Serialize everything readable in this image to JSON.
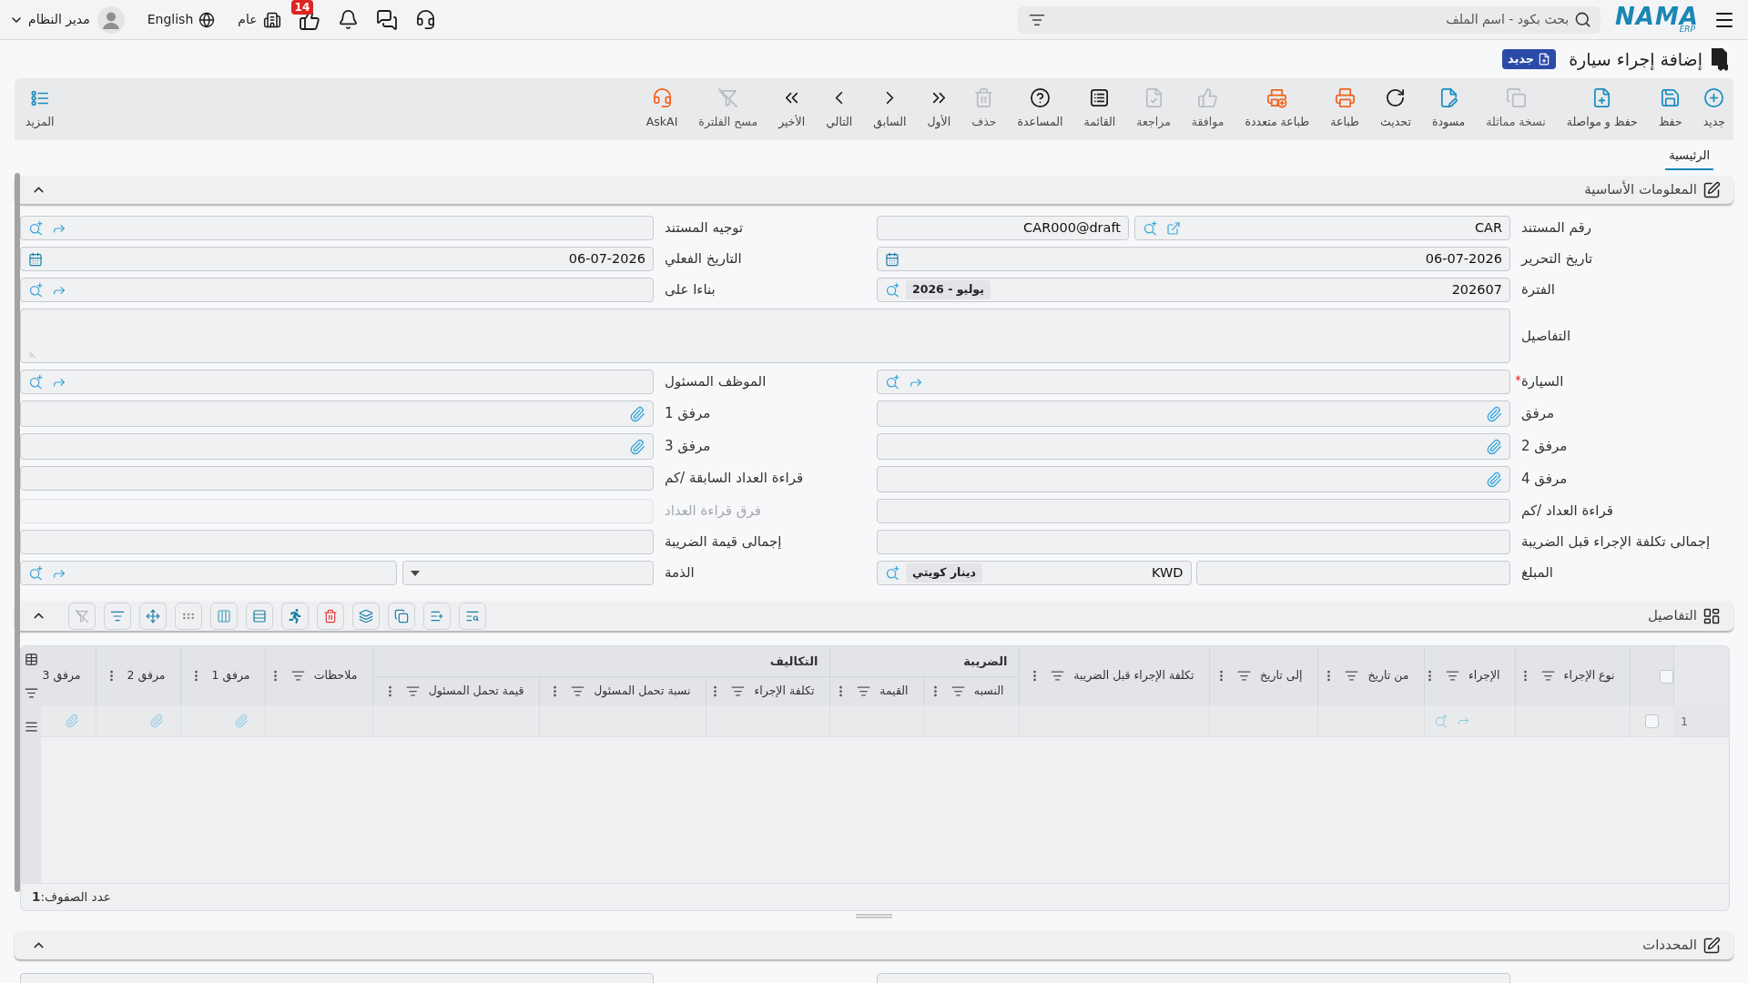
{
  "top_bar": {
    "logo": {
      "name": "NAMA",
      "suffix": "ERP"
    },
    "search": {
      "placeholder": "بحث بكود - اسم الملف"
    },
    "notifications": {
      "badge": "14"
    },
    "company": {
      "label": "عام"
    },
    "language": {
      "label": "English"
    },
    "user": {
      "name": "مدير النظام"
    }
  },
  "page": {
    "title": "إضافة إجراء سيارة",
    "status_badge": "جديد"
  },
  "toolbar": {
    "actions": [
      {
        "label": "جديد",
        "disabled": false
      },
      {
        "label": "حفظ",
        "disabled": false
      },
      {
        "label": "حفظ و مواصلة",
        "disabled": false
      },
      {
        "label": "نسخة مماثلة",
        "disabled": true
      },
      {
        "label": "مسودة",
        "disabled": false
      },
      {
        "label": "تحديث",
        "disabled": false
      },
      {
        "label": "طباعة",
        "disabled": false
      },
      {
        "label": "طباعة متعددة",
        "disabled": false
      },
      {
        "label": "موافقة",
        "disabled": true
      },
      {
        "label": "مراجعة",
        "disabled": true
      },
      {
        "label": "القائمة",
        "disabled": false
      },
      {
        "label": "المساعدة",
        "disabled": false
      },
      {
        "label": "حذف",
        "disabled": true
      },
      {
        "label": "الأول",
        "disabled": false
      },
      {
        "label": "السابق",
        "disabled": false
      },
      {
        "label": "التالي",
        "disabled": false
      },
      {
        "label": "الأخير",
        "disabled": false
      },
      {
        "label": "مسح الفلترة",
        "disabled": true
      },
      {
        "label": "AskAI",
        "disabled": false
      }
    ],
    "more": {
      "label": "المزيد"
    }
  },
  "tabs": [
    {
      "label": "الرئيسية",
      "selected": true
    }
  ],
  "basic_info": {
    "title": "المعلومات الأساسية",
    "expanded": true,
    "fields": [
      {
        "kind": "doc_number",
        "label": "رقم المستند",
        "value": "CAR",
        "serial": "CAR000@draft",
        "required": false,
        "disabled": false
      },
      {
        "kind": "lookup",
        "label": "توجيه المستند",
        "required": false,
        "disabled": false
      },
      {
        "kind": "date",
        "label": "تاريخ التحرير",
        "value": "06-07-2026",
        "required": false,
        "disabled": false
      },
      {
        "kind": "date",
        "label": "التاريخ الفعلي",
        "value": "06-07-2026",
        "required": false,
        "disabled": false
      },
      {
        "kind": "picker",
        "label": "الفترة",
        "value": "202607",
        "chip": "يوليو - 2026",
        "required": false,
        "disabled": false
      },
      {
        "kind": "lookup",
        "label": "بناءا على",
        "required": false,
        "disabled": false
      },
      {
        "kind": "textarea",
        "label": "التفاصيل",
        "required": false,
        "disabled": false
      },
      {
        "kind": "lookup",
        "label": "السيارة",
        "required": true,
        "disabled": false
      },
      {
        "kind": "lookup",
        "label": "الموظف المسئول",
        "required": false,
        "disabled": false
      },
      {
        "kind": "attachment",
        "label": "مرفق",
        "required": false,
        "disabled": false
      },
      {
        "kind": "attachment",
        "label": "مرفق 1",
        "required": false,
        "disabled": false
      },
      {
        "kind": "attachment",
        "label": "مرفق 2",
        "required": false,
        "disabled": false
      },
      {
        "kind": "attachment",
        "label": "مرفق 3",
        "required": false,
        "disabled": false
      },
      {
        "kind": "attachment",
        "label": "مرفق 4",
        "required": false,
        "disabled": false
      },
      {
        "kind": "text",
        "label": "قراءة العداد السابقة /كم",
        "required": false,
        "disabled": false
      },
      {
        "kind": "text",
        "label": "قراءة العداد /كم",
        "required": false,
        "disabled": false
      },
      {
        "kind": "text",
        "label": "فرق قراءة العداد",
        "required": false,
        "disabled": true
      },
      {
        "kind": "text",
        "label": "إجمالى تكلفة الإجراء قبل الضريبة",
        "required": false,
        "disabled": false
      },
      {
        "kind": "text",
        "label": "إجمالى قيمة الضريبة",
        "required": false,
        "disabled": false
      },
      {
        "kind": "amount",
        "label": "المبلغ",
        "currency": "KWD",
        "currency_name": "دينار كويتي",
        "required": false,
        "disabled": false
      },
      {
        "kind": "select_lookup",
        "label": "الذمة",
        "required": false,
        "disabled": false
      }
    ]
  },
  "details": {
    "title": "التفاصيل",
    "expanded": true,
    "tools": [
      {
        "disabled": false
      },
      {
        "disabled": false
      },
      {
        "disabled": false
      },
      {
        "disabled": false
      },
      {
        "disabled": false
      },
      {
        "disabled": false
      },
      {
        "disabled": false
      },
      {
        "disabled": false
      },
      {
        "disabled": false
      },
      {
        "disabled": false
      },
      {
        "disabled": false
      },
      {
        "disabled": true
      }
    ],
    "table": {
      "header_checkbox": {
        "checked": false
      },
      "columns": [
        {
          "label": "نوع الإجراء",
          "kind": "text",
          "filterable": true,
          "menu": true
        },
        {
          "label": "الإجراء",
          "kind": "lookup",
          "filterable": true,
          "menu": true
        },
        {
          "label": "من تاريخ",
          "kind": "text",
          "filterable": true,
          "menu": true
        },
        {
          "label": "إلى تاريخ",
          "kind": "text",
          "filterable": true,
          "menu": true
        },
        {
          "label": "تكلفة الإجراء قبل الضريبة",
          "kind": "text",
          "filterable": true,
          "menu": true
        },
        {
          "label": "الضريبة",
          "kind": "group",
          "children": [
            {
              "label": "النسبه",
              "kind": "text",
              "filterable": true,
              "menu": true
            },
            {
              "label": "القيمة",
              "kind": "text",
              "filterable": true,
              "menu": true
            }
          ]
        },
        {
          "label": "التكاليف",
          "kind": "group",
          "children": [
            {
              "label": "تكلفة الإجراء",
              "kind": "text",
              "filterable": true,
              "menu": true
            },
            {
              "label": "نسبة تحمل المسئول",
              "kind": "text",
              "filterable": true,
              "menu": true
            },
            {
              "label": "قيمة تحمل المسئول",
              "kind": "text",
              "filterable": true,
              "menu": true
            }
          ]
        },
        {
          "label": "ملاحظات",
          "kind": "text",
          "filterable": true,
          "menu": true
        },
        {
          "label": "مرفق 1",
          "kind": "attachment",
          "filterable": false,
          "menu": true
        },
        {
          "label": "مرفق 2",
          "kind": "attachment",
          "filterable": false,
          "menu": true
        },
        {
          "label": "مرفق 3",
          "kind": "attachment",
          "filterable": false,
          "menu": false
        }
      ],
      "rows": [
        {
          "number": "1",
          "checked": false
        }
      ],
      "footer": "عدد الصفوف:**1**"
    }
  },
  "limits": {
    "title": "المحددات",
    "expanded": true
  }
}
